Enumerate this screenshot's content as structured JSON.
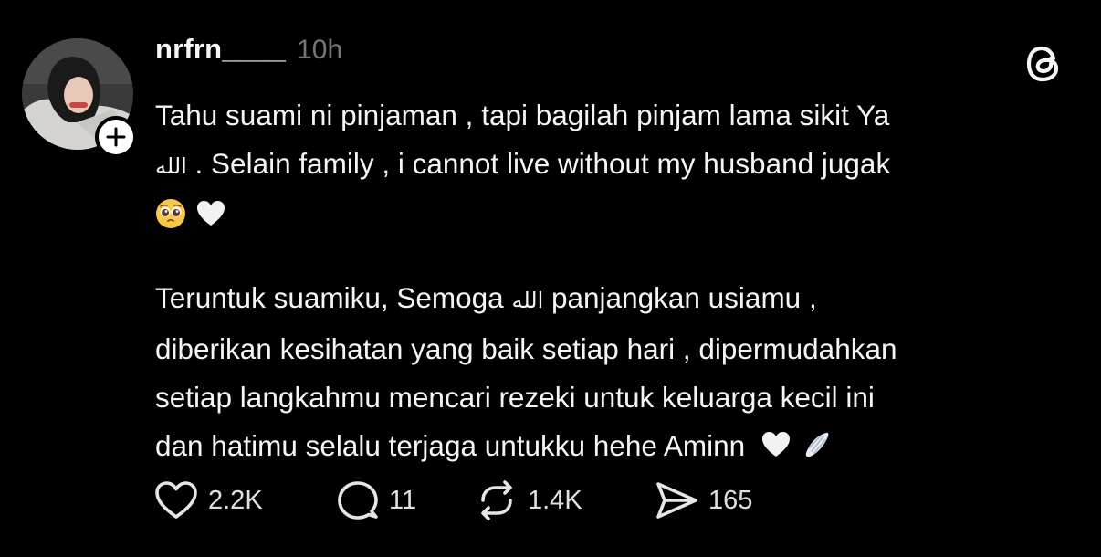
{
  "post": {
    "username": "nrfrn____",
    "timestamp": "10h",
    "paragraph1": {
      "line1": "Tahu suami ni pinjaman , tapi bagilah pinjam lama sikit Ya",
      "line2_arabic": "الله",
      "line2_text": " . Selain family , i cannot live without my husband jugak",
      "line3_emojis": [
        "pleading-face-emoji",
        "white-heart-emoji"
      ]
    },
    "paragraph2": {
      "line1_a": "Teruntuk suamiku, Semoga ",
      "line1_arabic": "الله",
      "line1_b": " panjangkan usiamu ,",
      "line2": "diberikan kesihatan yang baik setiap hari , dipermudahkan",
      "line3": "setiap langkahmu mencari rezeki untuk keluarga kecil ini",
      "line4": "dan hatimu selalu terjaga untukku hehe Aminn",
      "line4_emojis": [
        "white-heart-emoji",
        "wing-emoji"
      ]
    }
  },
  "actions": {
    "likes": "2.2K",
    "replies": "11",
    "reposts": "1.4K",
    "shares": "165"
  },
  "icons": {
    "app_logo": "threads-logo-icon",
    "follow": "plus-icon",
    "like": "heart-outline-icon",
    "reply": "comment-bubble-icon",
    "repost": "repost-arrows-icon",
    "share": "paper-plane-icon"
  },
  "colors": {
    "background": "#000000",
    "text": "#f3f5f7",
    "muted": "#777777"
  }
}
